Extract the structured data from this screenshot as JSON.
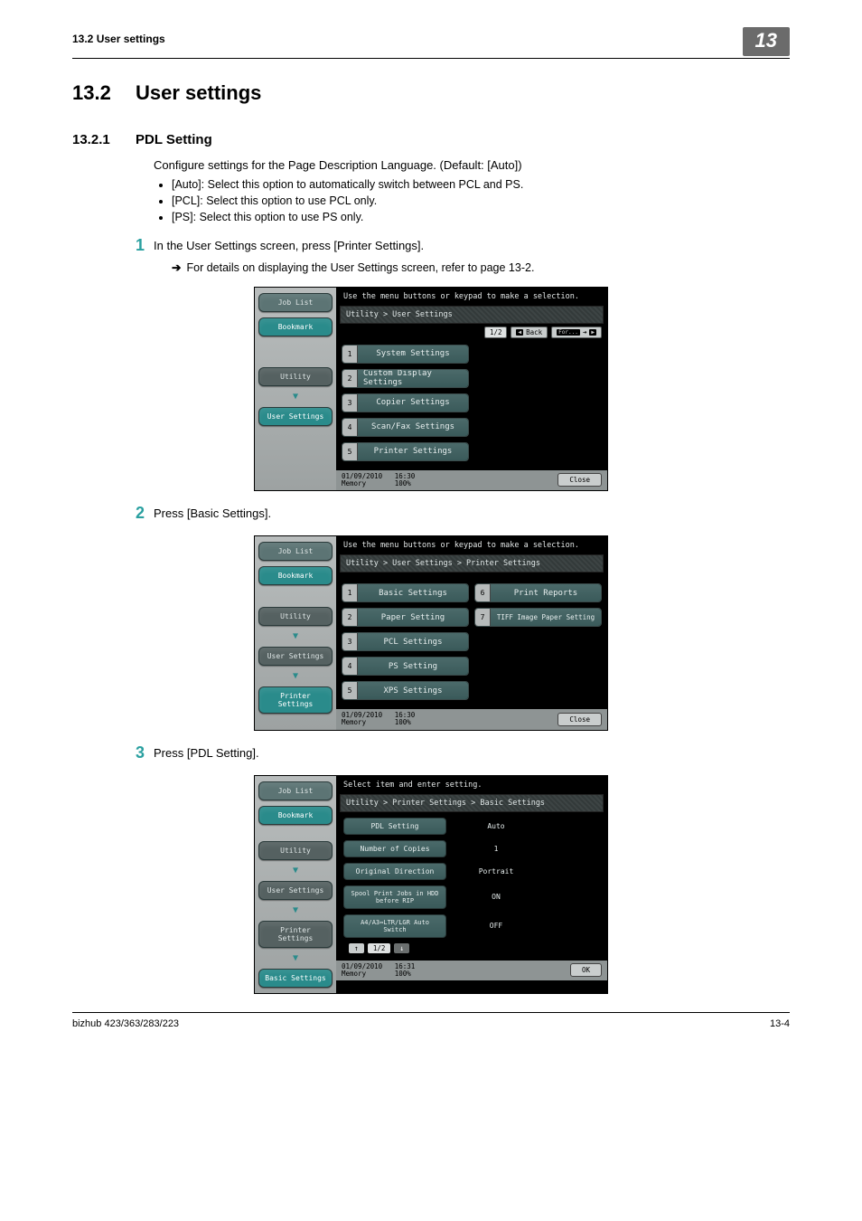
{
  "running_head": {
    "left": "13.2    User settings",
    "tab": "13"
  },
  "heading": {
    "number": "13.2",
    "text": "User settings"
  },
  "subheading": {
    "number": "13.2.1",
    "text": "PDL Setting"
  },
  "intro": "Configure settings for the Page Description Language. (Default: [Auto])",
  "bullets": [
    "[Auto]: Select this option to automatically switch between PCL and PS.",
    "[PCL]: Select this option to use PCL only.",
    "[PS]: Select this option to use PS only."
  ],
  "steps": {
    "s1": {
      "num": "1",
      "text": "In the User Settings screen, press [Printer Settings].",
      "detail": "For details on displaying the User Settings screen, refer to page 13-2."
    },
    "s2": {
      "num": "2",
      "text": "Press [Basic Settings]."
    },
    "s3": {
      "num": "3",
      "text": "Press [PDL Setting]."
    }
  },
  "panel_common": {
    "joblist": "Job List",
    "bookmark": "Bookmark",
    "utility": "Utility",
    "usersettings": "User Settings",
    "printersettings": "Printer Settings",
    "basicsettings": "Basic Settings",
    "close": "Close",
    "ok": "OK",
    "date": "01/09/2010",
    "time1": "16:30",
    "time2": "16:31",
    "mem": "Memory",
    "mempct": "100%",
    "back": "Back",
    "page12": "1/2"
  },
  "panel1": {
    "instr": "Use the menu buttons or keypad to make a selection.",
    "crumb": "Utility > User Settings",
    "items": [
      {
        "n": "1",
        "label": "System Settings"
      },
      {
        "n": "2",
        "label": "Custom Display Settings"
      },
      {
        "n": "3",
        "label": "Copier Settings"
      },
      {
        "n": "4",
        "label": "Scan/Fax Settings"
      },
      {
        "n": "5",
        "label": "Printer Settings"
      }
    ]
  },
  "panel2": {
    "instr": "Use the menu buttons or keypad to make a selection.",
    "crumb": "Utility > User Settings > Printer Settings",
    "left": [
      {
        "n": "1",
        "label": "Basic Settings"
      },
      {
        "n": "2",
        "label": "Paper Setting"
      },
      {
        "n": "3",
        "label": "PCL Settings"
      },
      {
        "n": "4",
        "label": "PS Setting"
      },
      {
        "n": "5",
        "label": "XPS Settings"
      }
    ],
    "right": [
      {
        "n": "6",
        "label": "Print Reports"
      },
      {
        "n": "7",
        "label": "TIFF Image Paper Setting"
      }
    ]
  },
  "panel3": {
    "instr": "Select item and enter setting.",
    "crumb": "Utility > Printer Settings > Basic Settings",
    "rows": [
      {
        "label": "PDL Setting",
        "value": "Auto"
      },
      {
        "label": "Number of Copies",
        "value": "1"
      },
      {
        "label": "Original Direction",
        "value": "Portrait"
      },
      {
        "label": "Spool Print Jobs in HDD before RIP",
        "value": "ON"
      },
      {
        "label": "A4/A3⇔LTR/LGR Auto Switch",
        "value": "OFF"
      }
    ]
  },
  "footer": {
    "left": "bizhub 423/363/283/223",
    "right": "13-4"
  }
}
